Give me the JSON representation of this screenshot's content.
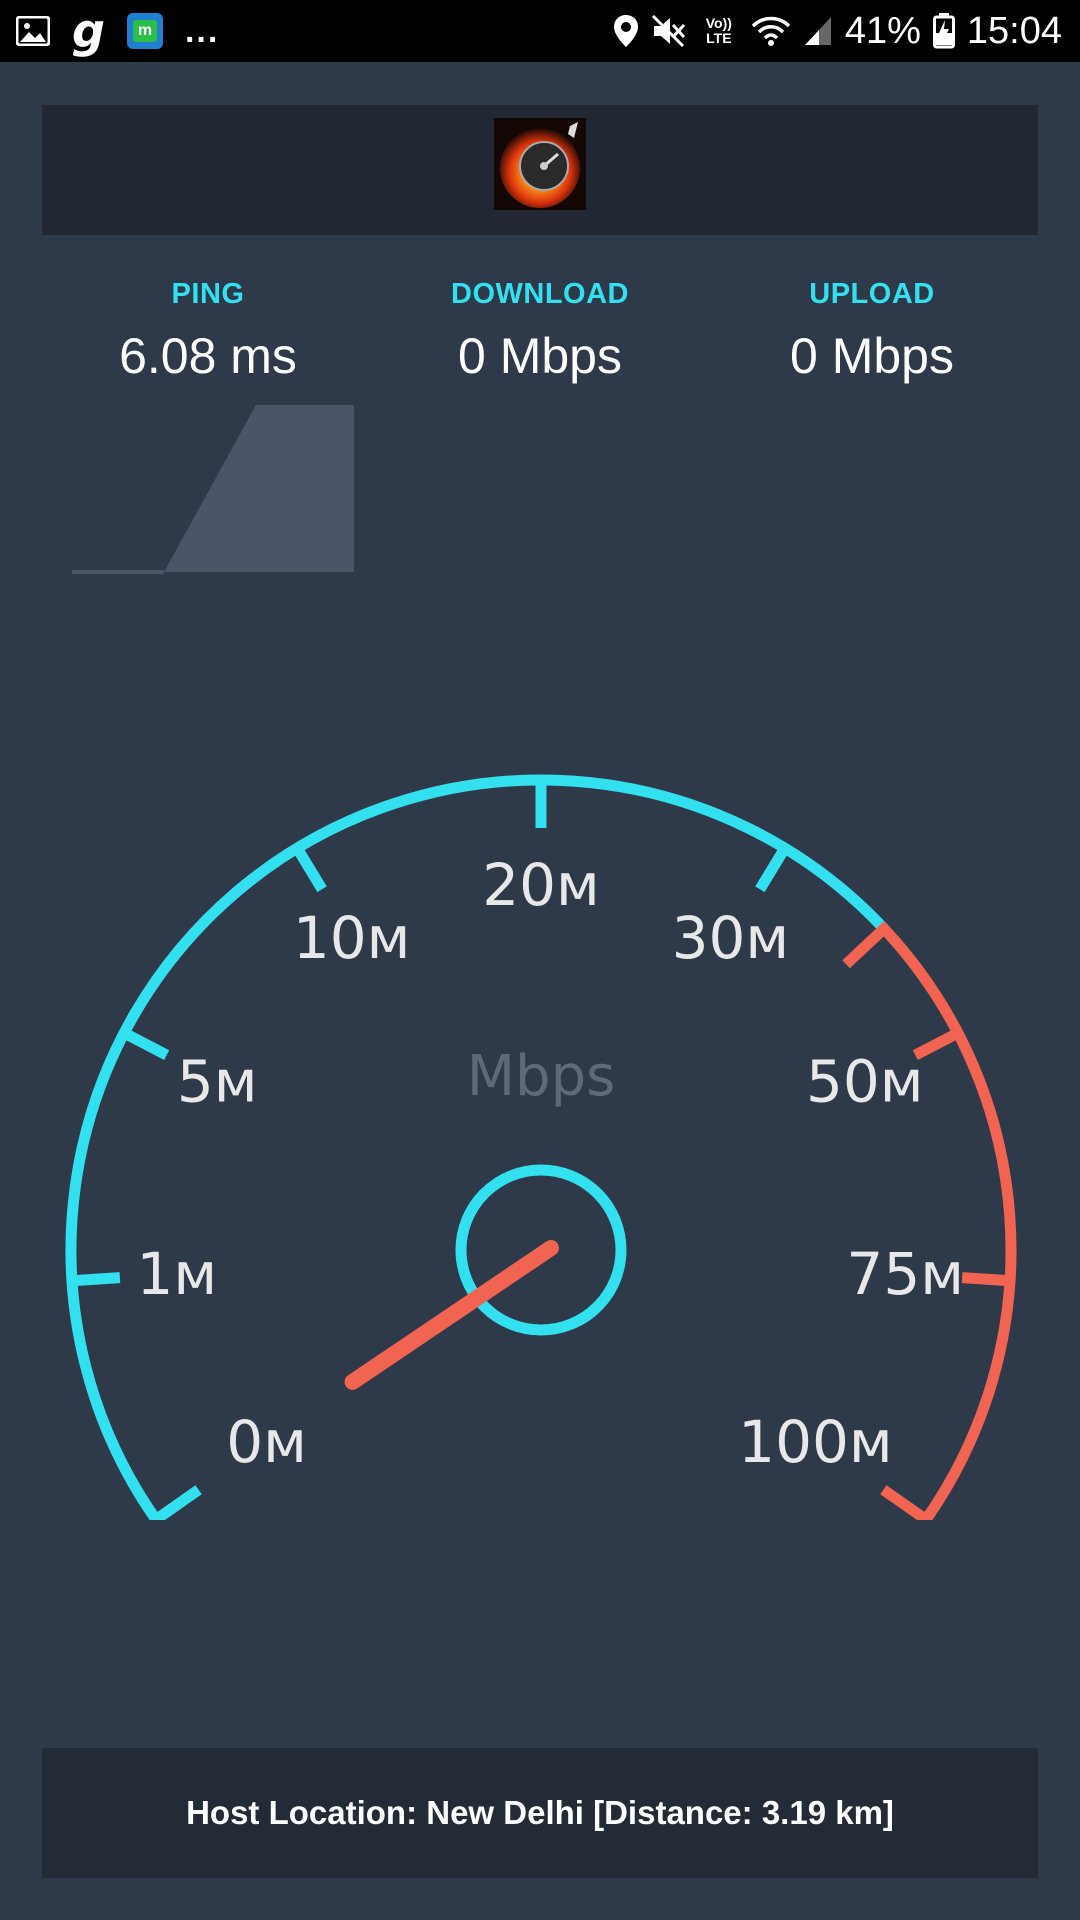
{
  "status_bar": {
    "left_icons": [
      "gallery-icon",
      "g-app-icon",
      "m-app-icon"
    ],
    "overflow": "...",
    "volte": "Vo)) LTE",
    "battery": "41%",
    "time": "15:04"
  },
  "colors": {
    "background": "#2e3a4a",
    "panel": "#212833",
    "accent_cyan": "#33e0f0",
    "accent_red": "#f26452"
  },
  "stats": {
    "ping": {
      "label": "PING",
      "value": "6.08 ms"
    },
    "download": {
      "label": "DOWNLOAD",
      "value": "0 Mbps"
    },
    "upload": {
      "label": "UPLOAD",
      "value": "0 Mbps"
    }
  },
  "gauge": {
    "unit": "Mbps",
    "ticks": [
      {
        "label": "0м",
        "zone": "normal"
      },
      {
        "label": "1м",
        "zone": "normal"
      },
      {
        "label": "5м",
        "zone": "normal"
      },
      {
        "label": "10м",
        "zone": "normal"
      },
      {
        "label": "20м",
        "zone": "normal"
      },
      {
        "label": "30м",
        "zone": "normal"
      },
      {
        "label": "50м",
        "zone": "high"
      },
      {
        "label": "75м",
        "zone": "high"
      },
      {
        "label": "100м",
        "zone": "high"
      }
    ],
    "needle_value": "0м"
  },
  "footer": {
    "host_location": "Host Location: New Delhi [Distance: 3.19 km]"
  }
}
